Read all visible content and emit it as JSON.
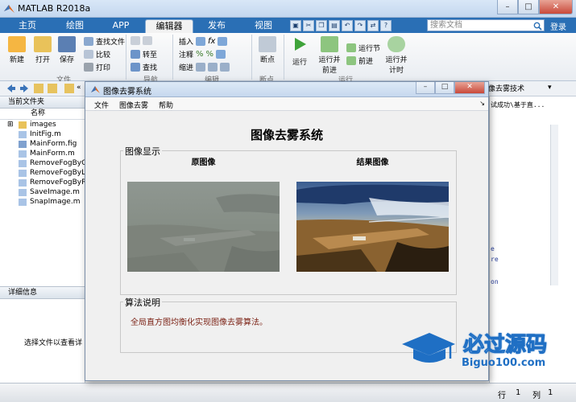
{
  "window": {
    "title": "MATLAB R2018a"
  },
  "tabs": [
    {
      "label": "主页"
    },
    {
      "label": "绘图"
    },
    {
      "label": "APP"
    },
    {
      "label": "编辑器"
    },
    {
      "label": "发布"
    },
    {
      "label": "视图"
    }
  ],
  "search": {
    "placeholder": "搜索文档"
  },
  "login": "登录",
  "ribbon": {
    "new": "新建",
    "open": "打开",
    "save": "保存",
    "find_files": "查找文件",
    "compare": "比较",
    "print": "打印",
    "goto": "转至",
    "find": "查找",
    "insert": "插入",
    "comment": "注释",
    "indent": "缩进",
    "breakpoints": "断点",
    "run": "运行",
    "run_advance": "运行并\n前进",
    "run_section": "运行节",
    "advance": "前进",
    "run_time": "运行并\n计时",
    "sections": {
      "file": "文件",
      "navigate": "导航",
      "edit": "编辑",
      "breakpoints": "断点",
      "run": "运行"
    }
  },
  "editor_tab": "像去雾技术",
  "editor_snippet": "试成功\\基于直...",
  "folder_panel": {
    "title": "当前文件夹",
    "name_column": "名称",
    "files": [
      {
        "name": "images",
        "type": "folder"
      },
      {
        "name": "InitFig.m",
        "type": "m"
      },
      {
        "name": "MainForm.fig",
        "type": "fig"
      },
      {
        "name": "MainForm.m",
        "type": "m"
      },
      {
        "name": "RemoveFogByG",
        "type": "m"
      },
      {
        "name": "RemoveFogByL",
        "type": "m"
      },
      {
        "name": "RemoveFogByR",
        "type": "m"
      },
      {
        "name": "SaveImage.m",
        "type": "m"
      },
      {
        "name": "SnapImage.m",
        "type": "m"
      }
    ]
  },
  "details_panel": {
    "title": "详细信息",
    "hint": "选择文件以查看详"
  },
  "code_bits": [
    "e",
    "re",
    "on"
  ],
  "status": {
    "line_label": "行",
    "line_value": "1",
    "col_label": "列",
    "col_value": "1"
  },
  "dialog": {
    "title": "图像去雾系统",
    "menu": {
      "file": "文件",
      "dehaze": "图像去雾",
      "help": "帮助"
    },
    "app_title": "图像去雾系统",
    "display_group": "图像显示",
    "orig_caption": "原图像",
    "result_caption": "结果图像",
    "algo_group": "算法说明",
    "algo_text": "全局直方图均衡化实现图像去雾算法。"
  },
  "watermark": {
    "brand": "必过源码",
    "site": "Biguo100.com"
  },
  "colors": {
    "ribbon_blue": "#2a6fb5",
    "algo_text": "#7a1f12",
    "watermark_blue": "#1f6fc4"
  }
}
